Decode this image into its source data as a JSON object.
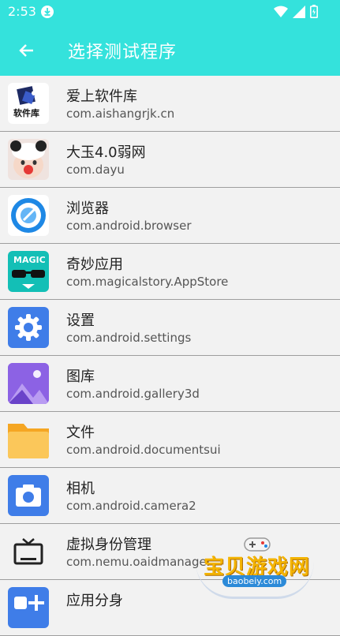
{
  "status": {
    "time": "2:53"
  },
  "toolbar": {
    "title": "选择测试程序"
  },
  "apps": [
    {
      "name": "爱上软件库",
      "package": "com.aishangrjk.cn",
      "icon_label": "软件库",
      "icon": "software-library-icon"
    },
    {
      "name": "大玉4.0弱网",
      "package": "com.dayu",
      "icon": "panda-avatar-icon"
    },
    {
      "name": "浏览器",
      "package": "com.android.browser",
      "icon": "browser-icon"
    },
    {
      "name": "奇妙应用",
      "package": "com.magicalstory.AppStore",
      "icon_label": "MAGIC",
      "icon": "magic-store-icon"
    },
    {
      "name": "设置",
      "package": "com.android.settings",
      "icon": "gear-icon"
    },
    {
      "name": "图库",
      "package": "com.android.gallery3d",
      "icon": "gallery-icon"
    },
    {
      "name": "文件",
      "package": "com.android.documentsui",
      "icon": "folder-icon"
    },
    {
      "name": "相机",
      "package": "com.android.camera2",
      "icon": "camera-icon"
    },
    {
      "name": "虚拟身份管理",
      "package": "com.nemu.oaidmanager",
      "icon": "tv-icon"
    },
    {
      "name": "应用分身",
      "package": "",
      "icon": "app-clone-icon"
    }
  ],
  "watermark": {
    "text": "宝贝游戏网",
    "url": "baobeiy.com"
  },
  "colors": {
    "accent": "#34e2dc",
    "divider": "#9e9e9e"
  }
}
